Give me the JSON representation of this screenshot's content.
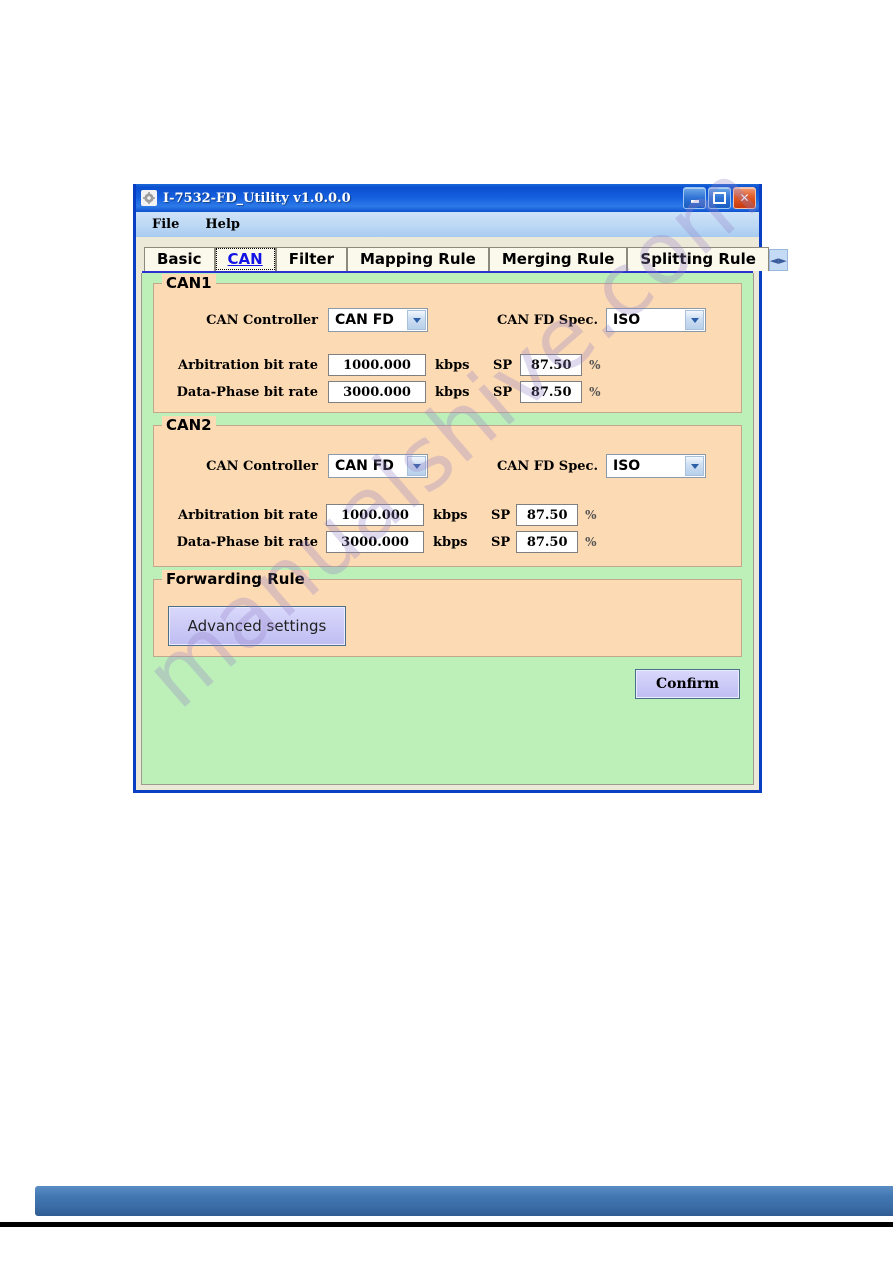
{
  "window": {
    "title": "I-7532-FD_Utility v1.0.0.0",
    "app_icon": "gear-icon",
    "controls": {
      "minimize": "minimize-icon",
      "maximize": "maximize-icon",
      "close": "close-icon"
    }
  },
  "menubar": {
    "items": [
      {
        "label": "File"
      },
      {
        "label": "Help"
      }
    ]
  },
  "tabs": {
    "items": [
      {
        "label": "Basic",
        "selected": false
      },
      {
        "label": "CAN",
        "selected": true
      },
      {
        "label": "Filter",
        "selected": false
      },
      {
        "label": "Mapping Rule",
        "selected": false
      },
      {
        "label": "Merging Rule",
        "selected": false
      },
      {
        "label": "Splitting Rule",
        "selected": false
      }
    ],
    "scroll_prev": "◄",
    "scroll_next": "►"
  },
  "can1": {
    "group_title": "CAN1",
    "controller_label": "CAN Controller",
    "controller_value": "CAN FD",
    "spec_label": "CAN FD Spec.",
    "spec_value": "ISO",
    "arbitration_label": "Arbitration bit rate",
    "arbitration_value": "1000.000",
    "arbitration_unit": "kbps",
    "arbitration_sp_label": "SP",
    "arbitration_sp_value": "87.50",
    "arbitration_sp_unit": "%",
    "dataphase_label": "Data-Phase bit rate",
    "dataphase_value": "3000.000",
    "dataphase_unit": "kbps",
    "dataphase_sp_label": "SP",
    "dataphase_sp_value": "87.50",
    "dataphase_sp_unit": "%"
  },
  "can2": {
    "group_title": "CAN2",
    "controller_label": "CAN Controller",
    "controller_value": "CAN FD",
    "spec_label": "CAN FD Spec.",
    "spec_value": "ISO",
    "arbitration_label": "Arbitration bit rate",
    "arbitration_value": "1000.000",
    "arbitration_unit": "kbps",
    "arbitration_sp_label": "SP",
    "arbitration_sp_value": "87.50",
    "arbitration_sp_unit": "%",
    "dataphase_label": "Data-Phase bit rate",
    "dataphase_value": "3000.000",
    "dataphase_unit": "kbps",
    "dataphase_sp_label": "SP",
    "dataphase_sp_value": "87.50",
    "dataphase_sp_unit": "%"
  },
  "forwarding": {
    "group_title": "Forwarding Rule",
    "advanced_button": "Advanced settings"
  },
  "actions": {
    "confirm": "Confirm"
  },
  "watermark": {
    "text": "manualshive.com"
  },
  "colors": {
    "title_bar": "#0b4fcf",
    "window_border": "#0a3fc4",
    "page_background": "#bdf0b9",
    "group_background": "#fcdab4",
    "selected_tab_text": "#1313e6",
    "button_face": "#cbc9f6",
    "close_button": "#e05a26"
  }
}
